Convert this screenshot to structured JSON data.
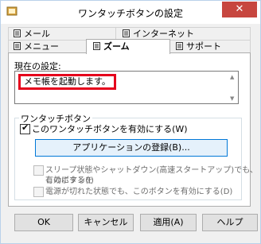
{
  "window": {
    "title": "ワンタッチボタンの設定",
    "close_symbol": "✕"
  },
  "tabs_back": [
    {
      "label": "メール",
      "icon": "document-icon"
    },
    {
      "label": "インターネット",
      "icon": "document-icon"
    }
  ],
  "tabs_front": [
    {
      "label": "メニュー",
      "icon": "document-icon"
    },
    {
      "label": "ズーム",
      "icon": "document-icon",
      "active": true
    },
    {
      "label": "サポート",
      "icon": "document-icon"
    }
  ],
  "current_setting": {
    "label": "現在の設定:",
    "value": "メモ帳を起動します。"
  },
  "onetouch_group": {
    "title": "ワンタッチボタン",
    "enable_checkbox": {
      "label": "このワンタッチボタンを有効にする(W)",
      "checked": true
    },
    "register_button": "アプリケーションの登録(B)...",
    "sleep_checkbox": {
      "line1": "スリープ状態やシャットダウン(高速スタートアップ)でも、このボタンを",
      "line2": "有効にする(I)",
      "checked": false
    },
    "power_off_checkbox": {
      "label": "電源が切れた状態でも、このボタンを有効にする(D)",
      "checked": false
    }
  },
  "buttons": {
    "ok": "OK",
    "cancel": "キャンセル",
    "apply": "適用(A)",
    "help": "ヘルプ"
  },
  "colors": {
    "highlight_border": "#e5001c",
    "close_button": "#c7463f"
  }
}
